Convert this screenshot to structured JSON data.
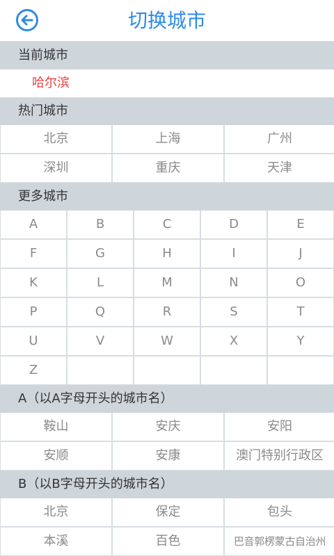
{
  "header": {
    "title": "切换城市"
  },
  "current": {
    "section_label": "当前城市",
    "city": "哈尔滨"
  },
  "hot": {
    "section_label": "热门城市",
    "cities": [
      "北京",
      "上海",
      "广州",
      "深圳",
      "重庆",
      "天津"
    ]
  },
  "more": {
    "section_label": "更多城市",
    "letters": [
      "A",
      "B",
      "C",
      "D",
      "E",
      "F",
      "G",
      "H",
      "I",
      "J",
      "K",
      "L",
      "M",
      "N",
      "O",
      "P",
      "Q",
      "R",
      "S",
      "T",
      "U",
      "V",
      "W",
      "X",
      "Y",
      "Z"
    ]
  },
  "group_a": {
    "section_label": "A（以A字母开头的城市名）",
    "cities": [
      "鞍山",
      "安庆",
      "安阳",
      "安顺",
      "安康",
      "澳门特别行政区"
    ]
  },
  "group_b": {
    "section_label": "B（以B字母开头的城市名）",
    "cities": [
      "北京",
      "保定",
      "包头",
      "本溪",
      "百色",
      "巴音郭楞蒙古自治州"
    ]
  },
  "colors": {
    "accent": "#2d8be6",
    "current_city": "#e8413f",
    "section_bg": "#cfd6db"
  }
}
